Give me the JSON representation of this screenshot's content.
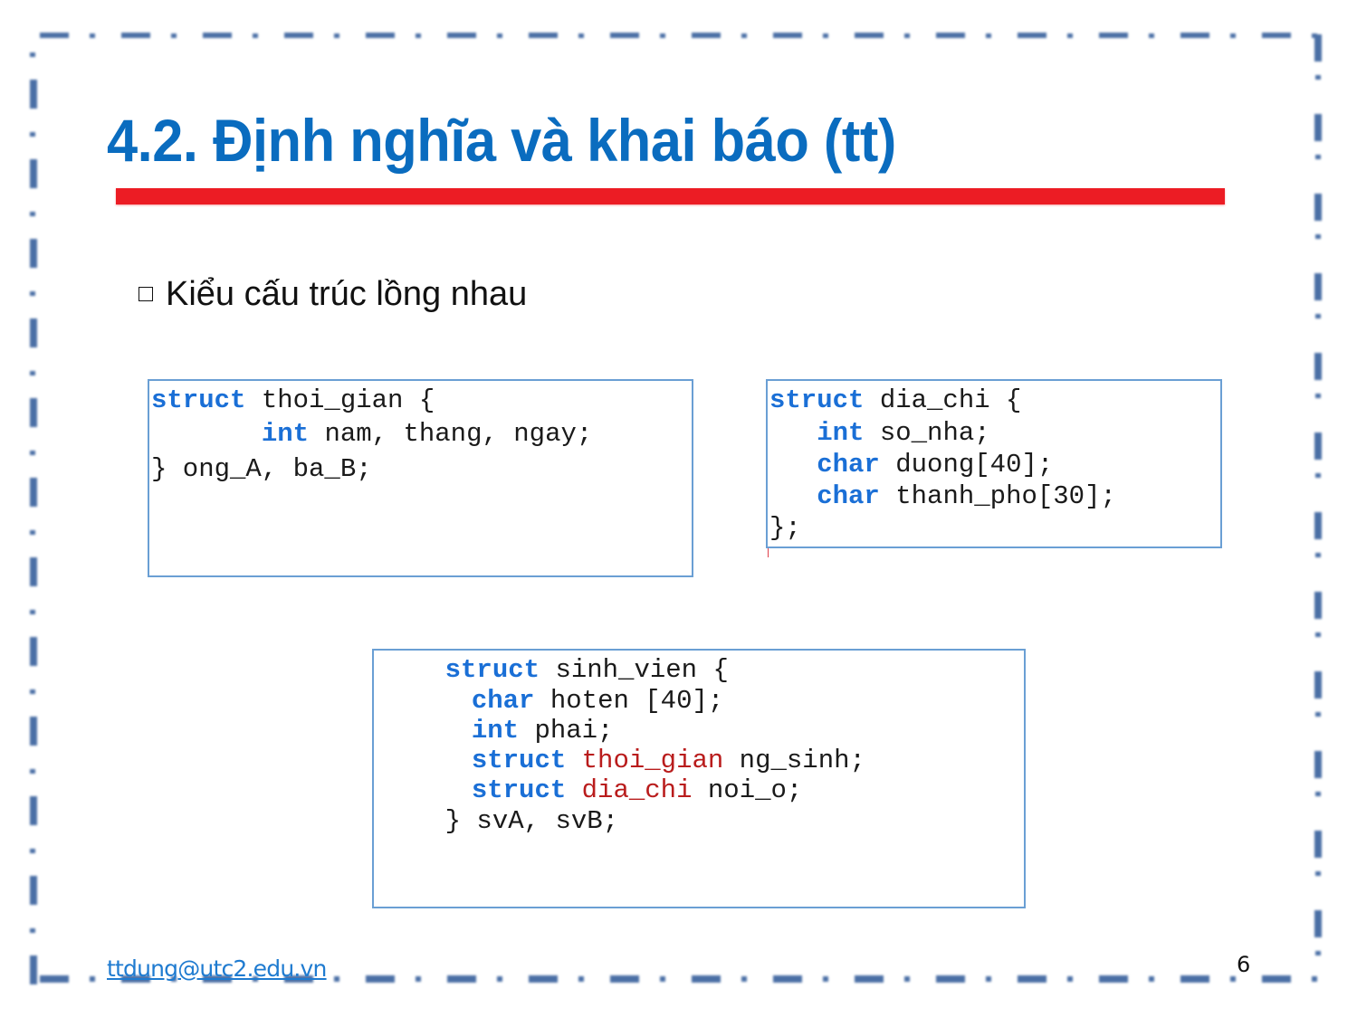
{
  "slide": {
    "title": "4.2. Định nghĩa và khai báo (tt)",
    "accent_color": "#0a6cbf",
    "underline_color": "#ec1c24",
    "border_color": "#4a6fa5",
    "bullet": {
      "icon": "hollow-square-bullet",
      "text": "Kiểu cấu trúc lồng nhau"
    }
  },
  "code_boxes": {
    "thoi_gian": {
      "lines": [
        {
          "kw": "struct",
          "rest": " thoi_gian {"
        },
        {
          "indent": "       ",
          "kw": "int",
          "rest": " nam, thang, ngay;"
        },
        {
          "rest": "} ong_A, ba_B;"
        }
      ]
    },
    "dia_chi": {
      "lines": [
        {
          "kw": "struct",
          "rest": " dia_chi {"
        },
        {
          "indent": "   ",
          "kw": "int",
          "rest": " so_nha;"
        },
        {
          "indent": "   ",
          "kw": "char",
          "rest": " duong[40];"
        },
        {
          "indent": "   ",
          "kw": "char",
          "rest": " thanh_pho[30];"
        },
        {
          "rest": "};"
        }
      ]
    },
    "sinh_vien": {
      "lines": [
        {
          "indent": "    ",
          "kw": "struct",
          "rest": " sinh_vien {"
        },
        {
          "indent": "       ",
          "kw": "char",
          "rest": " hoten [40];"
        },
        {
          "indent": "       ",
          "kw": "int",
          "rest": " phai;"
        },
        {
          "indent": "       ",
          "kw": "struct",
          "type": " thoi_gian",
          "rest": " ng_sinh;"
        },
        {
          "indent": "       ",
          "kw": "struct",
          "type": " dia_chi",
          "rest": " noi_o;"
        },
        {
          "indent": "    ",
          "rest": "} svA, svB;"
        }
      ]
    },
    "keyword_color": "#1a6fd6",
    "type_color": "#b91c1c",
    "box_border_color": "#6a9fd4"
  },
  "footer": {
    "email": "ttdung@utc2.edu.vn",
    "page_number": "6"
  }
}
